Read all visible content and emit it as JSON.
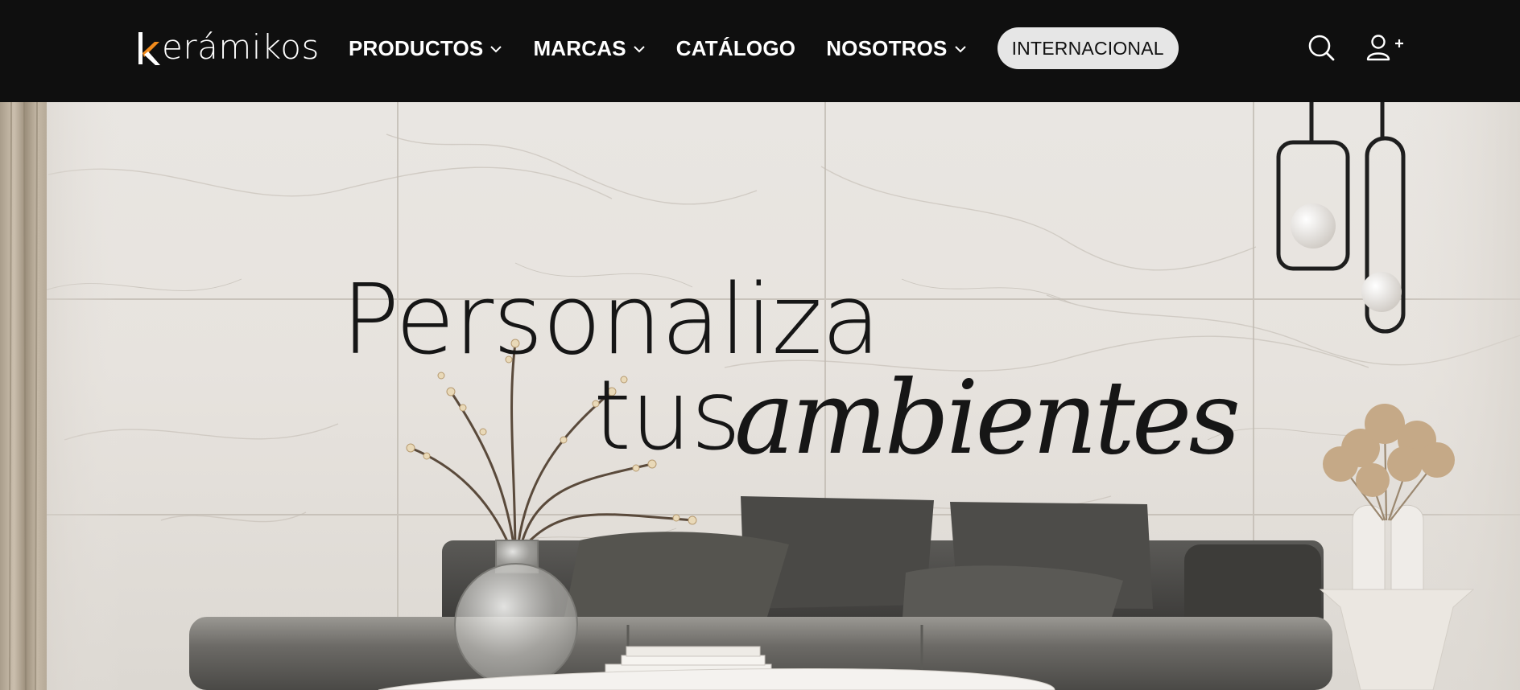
{
  "brand": {
    "logo_text": "erámikos",
    "logo_letter": "k",
    "accent_color": "#f08a1c"
  },
  "nav": {
    "items": [
      {
        "label": "PRODUCTOS",
        "has_dropdown": true
      },
      {
        "label": "MARCAS",
        "has_dropdown": true
      },
      {
        "label": "CATÁLOGO",
        "has_dropdown": false
      },
      {
        "label": "NOSOTROS",
        "has_dropdown": true
      }
    ],
    "pill_label": "INTERNACIONAL"
  },
  "header_icons": {
    "search": "search-icon",
    "account": "user-plus-icon"
  },
  "hero": {
    "line1": "Personaliza",
    "line2": "tus",
    "line3": "ambientes"
  },
  "colors": {
    "header_bg": "#0f0f0f",
    "nav_text": "#ffffff",
    "pill_bg": "#e6e6e6",
    "headline_text": "#161616"
  }
}
